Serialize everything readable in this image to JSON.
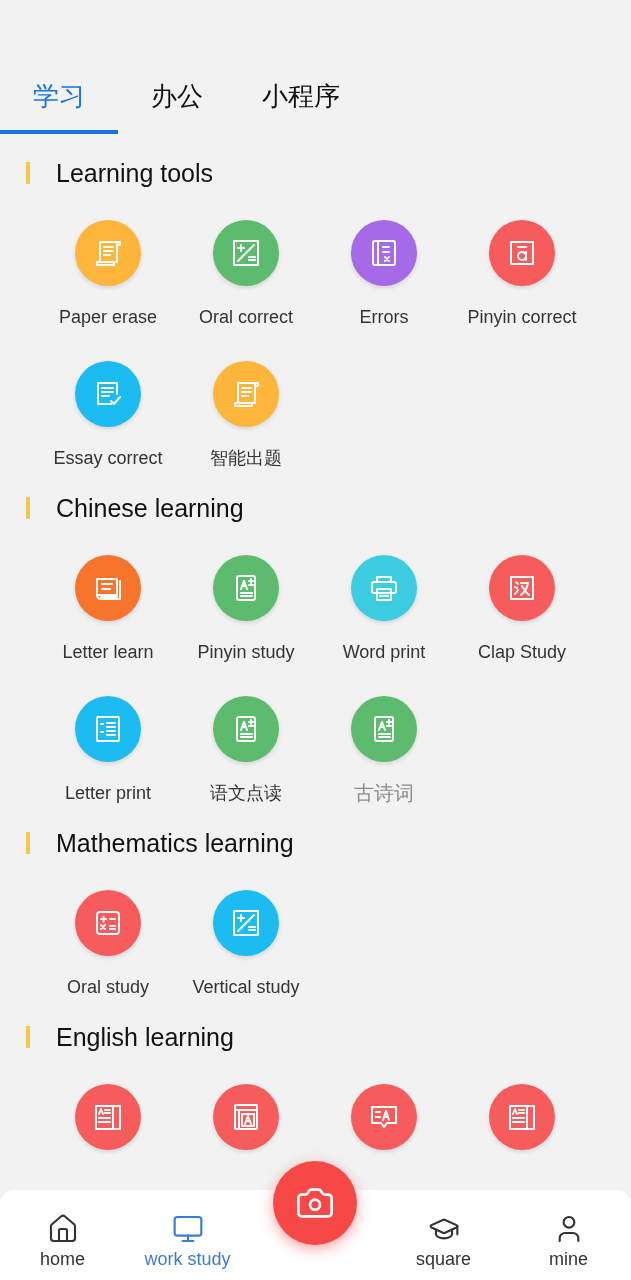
{
  "tabs": [
    {
      "label": "学习",
      "selected": true
    },
    {
      "label": "办公",
      "selected": false
    },
    {
      "label": "小程序",
      "selected": false
    }
  ],
  "sections": [
    {
      "title": "Learning tools",
      "items": [
        {
          "label": "Paper erase",
          "kind": "scroll",
          "color": "#fdb53c",
          "disabled": false
        },
        {
          "label": "Oral correct",
          "kind": "calc",
          "color": "#5dbb6e",
          "disabled": false
        },
        {
          "label": "Errors",
          "kind": "errors",
          "color": "#a66ae9",
          "disabled": false
        },
        {
          "label": "Pinyin correct",
          "kind": "pinyin",
          "color": "#f65c5c",
          "disabled": false
        },
        {
          "label": "Essay correct",
          "kind": "essay",
          "color": "#1cbcf2",
          "disabled": false
        },
        {
          "label": "智能出题",
          "kind": "scroll",
          "color": "#fdb53c",
          "disabled": false
        }
      ]
    },
    {
      "title": "Chinese learning",
      "items": [
        {
          "label": "Letter learn",
          "kind": "book",
          "color": "#f7742c",
          "disabled": false
        },
        {
          "label": "Pinyin study",
          "kind": "doc",
          "color": "#5dbb6e",
          "disabled": false
        },
        {
          "label": "Word print",
          "kind": "printer",
          "color": "#3ccde0",
          "disabled": false
        },
        {
          "label": "Clap Study",
          "kind": "char",
          "color": "#f65c5c",
          "disabled": false
        },
        {
          "label": "Letter print",
          "kind": "list",
          "color": "#1cbcf2",
          "disabled": false
        },
        {
          "label": "语文点读",
          "kind": "doc",
          "color": "#5dbb6e",
          "disabled": false
        },
        {
          "label": "古诗词",
          "kind": "doc",
          "color": "#5dbb6e",
          "disabled": true
        }
      ]
    },
    {
      "title": "Mathematics learning",
      "items": [
        {
          "label": "Oral study",
          "kind": "mathgrid",
          "color": "#f65c5c",
          "disabled": false
        },
        {
          "label": "Vertical study",
          "kind": "calc",
          "color": "#1cbcf2",
          "disabled": false
        }
      ]
    },
    {
      "title": "English learning",
      "items": [
        {
          "kind": "reader",
          "color": "#f65c5c"
        },
        {
          "kind": "wordbook",
          "color": "#f65c5c"
        },
        {
          "kind": "chat",
          "color": "#f65c5c"
        },
        {
          "kind": "reader",
          "color": "#f65c5c"
        }
      ]
    }
  ],
  "bottom_nav": [
    {
      "label": "home",
      "kind": "home",
      "selected": false
    },
    {
      "label": "work study",
      "kind": "monitor",
      "selected": true
    },
    {
      "label": "square",
      "kind": "cap",
      "selected": false
    },
    {
      "label": "mine",
      "kind": "user",
      "selected": false
    }
  ]
}
